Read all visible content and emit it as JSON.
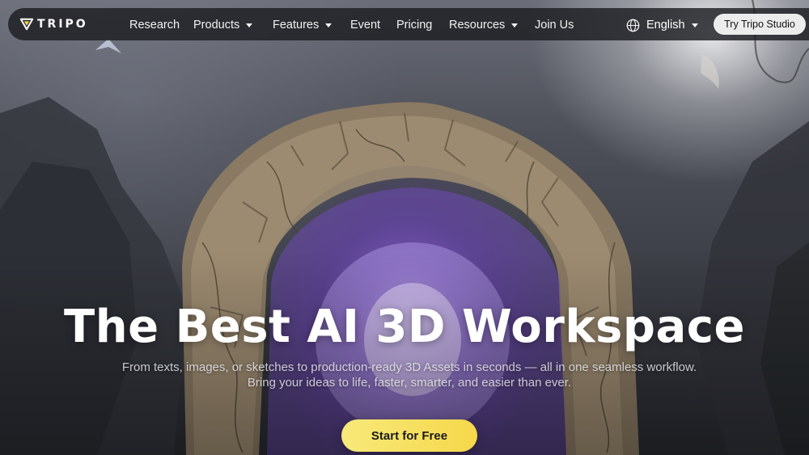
{
  "brand": {
    "name": "TRIPO",
    "logo_icon": "tripo-logo-icon"
  },
  "nav": {
    "items": [
      {
        "label": "Research",
        "dropdown": false
      },
      {
        "label": "Products",
        "dropdown": true
      },
      {
        "label": "Features",
        "dropdown": true
      },
      {
        "label": "Event",
        "dropdown": false
      },
      {
        "label": "Pricing",
        "dropdown": false
      },
      {
        "label": "Resources",
        "dropdown": true
      },
      {
        "label": "Join Us",
        "dropdown": false
      }
    ],
    "language": {
      "label": "English",
      "icon": "globe-icon"
    },
    "cta_label": "Try Tripo Studio"
  },
  "hero": {
    "title": "The Best AI 3D Workspace",
    "subtitle_line1": "From texts, images, or sketches to production-ready 3D Assets in seconds — all in one seamless workflow.",
    "subtitle_line2": "Bring your ideas to life, faster, smarter, and easier than ever.",
    "cta_label": "Start for Free"
  },
  "colors": {
    "accent": "#f6d84a",
    "nav_bg": "#1c1d21",
    "portal_glow": "#9a6ee8"
  }
}
